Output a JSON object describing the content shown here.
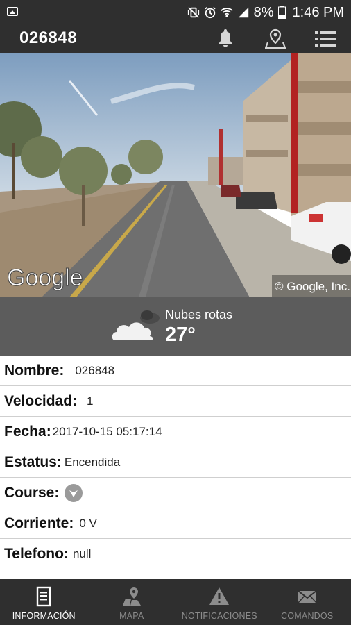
{
  "status_bar": {
    "battery": "8%",
    "time": "1:46 PM",
    "icons": [
      "image-notification-icon",
      "vibrate-mute-icon",
      "alarm-icon",
      "wifi-icon",
      "signal-icon",
      "battery-icon"
    ]
  },
  "toolbar": {
    "title": "026848",
    "icons": [
      "bell-icon",
      "map-pin-icon",
      "list-menu-icon"
    ]
  },
  "street_view": {
    "watermark": "Google",
    "copyright": "© Google, Inc."
  },
  "weather": {
    "description": "Nubes rotas",
    "temperature": "27°",
    "icon": "broken-clouds-icon"
  },
  "info": {
    "rows": [
      {
        "label": "Nombre:",
        "value": "026848"
      },
      {
        "label": "Velocidad:",
        "value": "1"
      },
      {
        "label": "Fecha:",
        "value": "2017-10-15 05:17:14"
      },
      {
        "label": "Estatus:",
        "value": "Encendida"
      },
      {
        "label": "Course:",
        "value": ""
      },
      {
        "label": "Corriente:",
        "value": "0 V"
      },
      {
        "label": "Telefono:",
        "value": "null"
      }
    ]
  },
  "bottom_nav": {
    "tabs": [
      {
        "label": "INFORMACIÓN",
        "icon": "document-icon",
        "active": true
      },
      {
        "label": "MAPA",
        "icon": "map-icon",
        "active": false
      },
      {
        "label": "NOTIFICACIONES",
        "icon": "warning-icon",
        "active": false
      },
      {
        "label": "COMANDOS",
        "icon": "envelope-icon",
        "active": false
      }
    ]
  },
  "colors": {
    "bar_background": "#2f2f2f",
    "weather_background": "#5c5c5c",
    "inactive_tab": "#8c8c8c"
  }
}
